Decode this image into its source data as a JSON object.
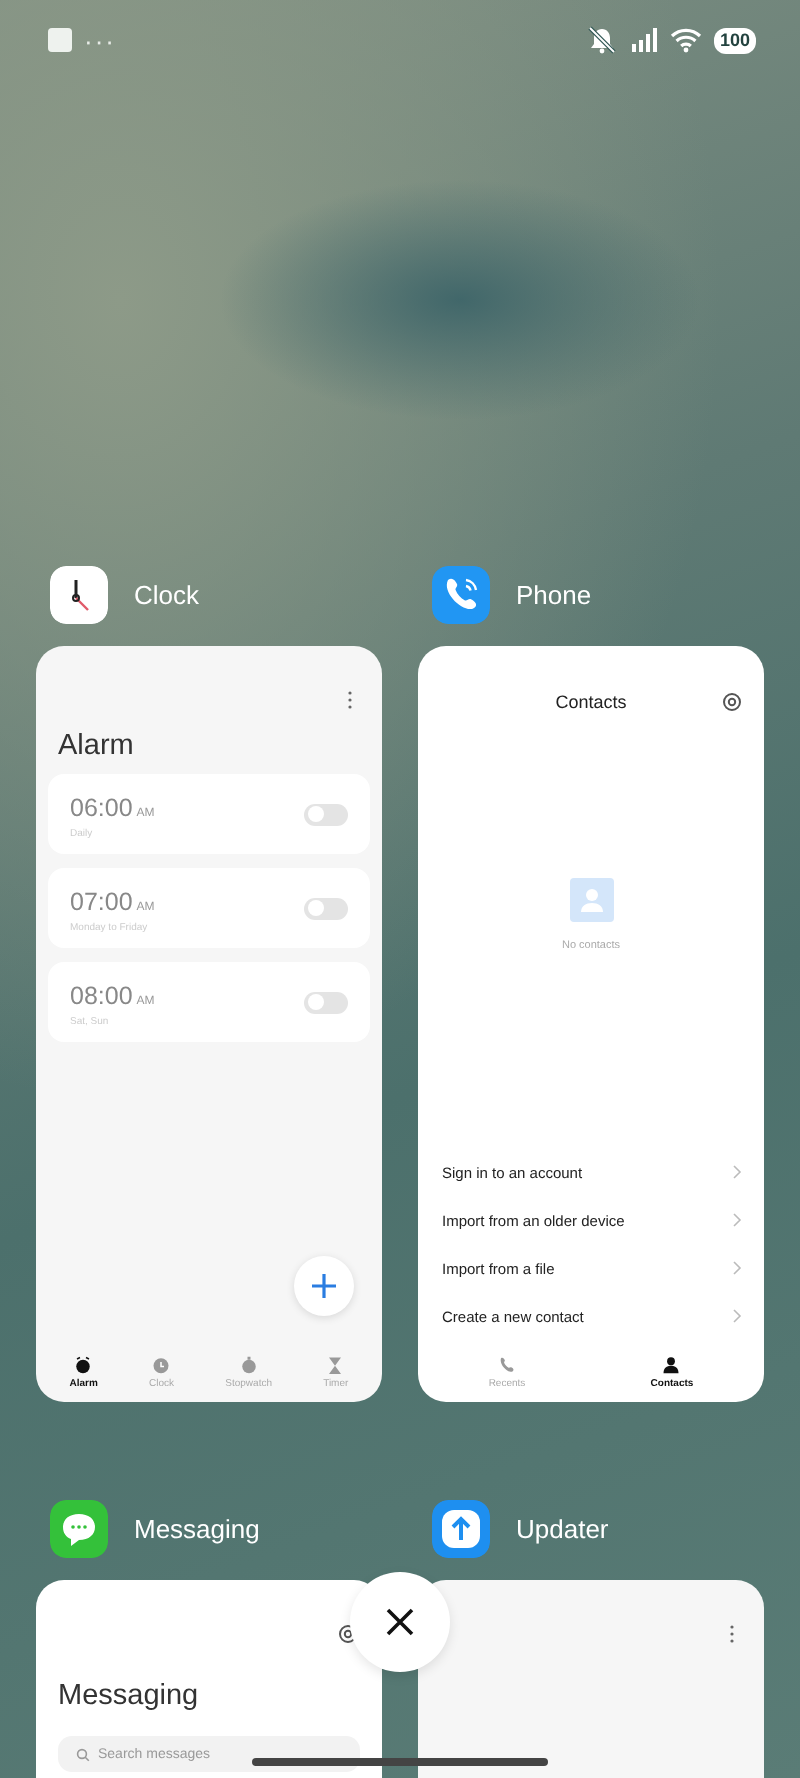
{
  "status_bar": {
    "more": "···",
    "battery": "100"
  },
  "apps": [
    {
      "name": "Clock",
      "kind": "clock",
      "screen": {
        "title": "Alarm",
        "alarms": [
          {
            "time": "06:00",
            "period": "AM",
            "repeat": "Daily",
            "on": false
          },
          {
            "time": "07:00",
            "period": "AM",
            "repeat": "Monday to Friday",
            "on": false
          },
          {
            "time": "08:00",
            "period": "AM",
            "repeat": "Sat, Sun",
            "on": false
          }
        ],
        "tabs": [
          {
            "label": "Alarm",
            "selected": true
          },
          {
            "label": "Clock",
            "selected": false
          },
          {
            "label": "Stopwatch",
            "selected": false
          },
          {
            "label": "Timer",
            "selected": false
          }
        ]
      }
    },
    {
      "name": "Phone",
      "kind": "phone",
      "screen": {
        "title": "Contacts",
        "empty": "No contacts",
        "actions": [
          "Sign in to an account",
          "Import from an older device",
          "Import from a file",
          "Create a new contact"
        ],
        "tabs": [
          {
            "label": "Recents",
            "selected": false
          },
          {
            "label": "Contacts",
            "selected": true
          }
        ]
      }
    },
    {
      "name": "Messaging",
      "kind": "messaging",
      "screen": {
        "title": "Messaging",
        "search": {
          "placeholder": "Search messages"
        }
      }
    },
    {
      "name": "Updater",
      "kind": "updater"
    }
  ]
}
